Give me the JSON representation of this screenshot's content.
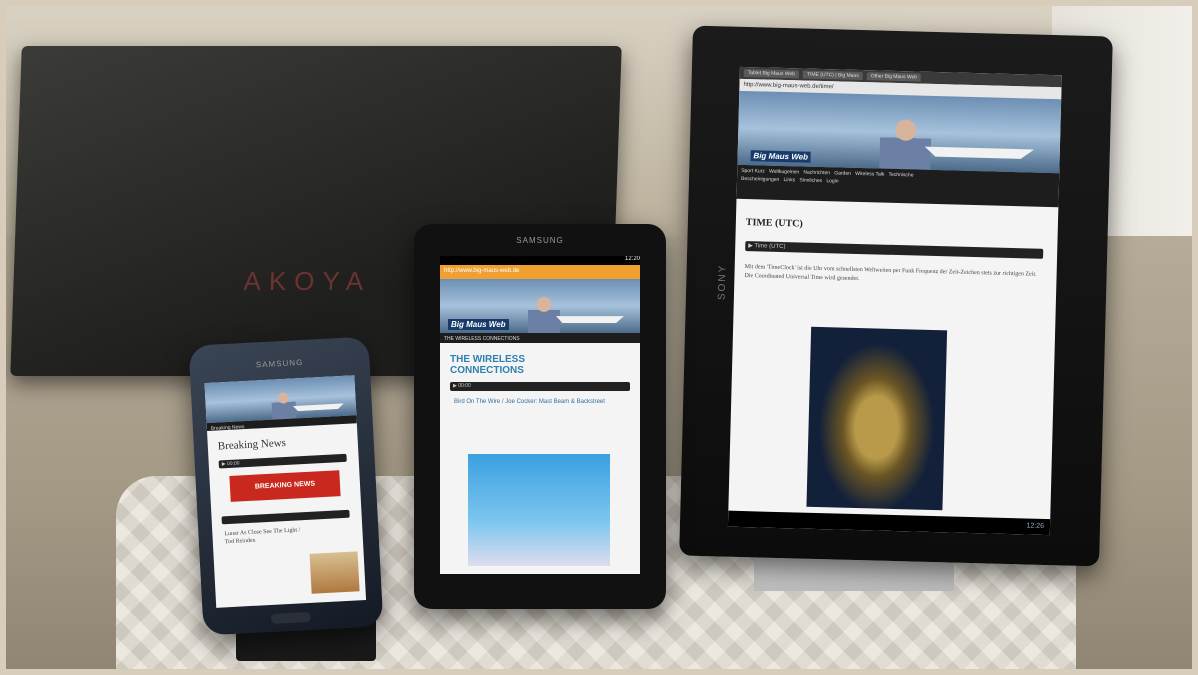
{
  "scene": {
    "laptop_brand": "AKOYA"
  },
  "phone": {
    "brand": "SAMSUNG",
    "site_label": "Breaking News",
    "heading": "Breaking News",
    "player_label": "▶ 00:00",
    "ad_text": "BREAKING NEWS",
    "story_text": "Lunar As Close See The Light / Tod Reindex"
  },
  "tablet7": {
    "brand": "SAMSUNG",
    "status_time": "12:20",
    "url": "http://www.big-maus-web.de",
    "logo": "Big Maus Web",
    "nav_label": "THE WIRELESS CONNECTIONS",
    "headline": "THE WIRELESS CONNECTIONS",
    "player_label": "▶ 00:00",
    "subhead": "Bird On The Wire / Joe Cocker: Mast Beam & Backstreet"
  },
  "tablet10": {
    "brand": "SONY",
    "tabs": [
      "Tablet Big Maus Web",
      "TIME (UTC) | Big Maus",
      "Other Big Maus Web"
    ],
    "url": "http://www.big-maus-web.de/time/",
    "logo": "Big Maus Web",
    "nav": [
      "Sport Kurz",
      "Weltkugelnen",
      "Nachrichten",
      "Garden",
      "Wireless Talk",
      "Technische",
      "Bescheinigungen",
      "Links",
      "Sinnliches",
      "Login"
    ],
    "headline": "TIME (UTC)",
    "player_label": "▶ Time (UTC)",
    "body": "Mit dem 'TimeClock' ist die Uhr vom schnellsten Weltweiten per Funk Frequenz der Zeit-Zeichen stets zur richtigen Zeit. Die Coordinated Universal Time wird gesendet.",
    "sys_time": "12:26"
  }
}
